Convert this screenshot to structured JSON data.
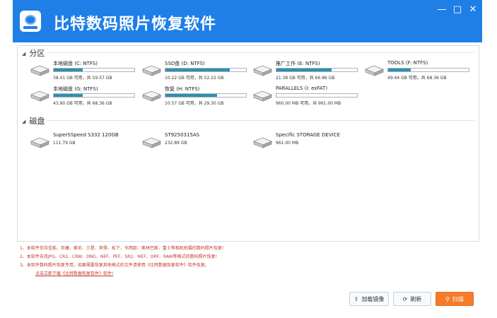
{
  "app": {
    "title": "比特数码照片恢复软件",
    "window_controls": {
      "minimize": "—",
      "maximize": "□",
      "close": "✕"
    }
  },
  "partitions": {
    "header": "分区",
    "items": [
      {
        "name": "本地磁盘 (C: NTFS)",
        "size": "38.41 GB 可用，共 59.57 GB",
        "used_fraction": 0.36
      },
      {
        "name": "SSD盘 (D: NTFS)",
        "size": "10.22 GB 可用，共 52.22 GB",
        "used_fraction": 0.8
      },
      {
        "name": "推广工作 (E: NTFS)",
        "size": "21.38 GB 可用，共 66.86 GB",
        "used_fraction": 0.68
      },
      {
        "name": "TOOLS (F: NTFS)",
        "size": "49.44 GB 可用，共 68.36 GB",
        "used_fraction": 0.28
      },
      {
        "name": "本地磁盘 (G: NTFS)",
        "size": "43.90 GB 可用，共 68.36 GB",
        "used_fraction": 0.36
      },
      {
        "name": "恢复 (H: NTFS)",
        "size": "10.57 GB 可用，共 29.30 GB",
        "used_fraction": 0.64
      },
      {
        "name": "PARALLELS (I: exFAT)",
        "size": "960.00 MB 可用，共 961.00 MB",
        "used_fraction": 0.0
      }
    ]
  },
  "disks": {
    "header": "磁盘",
    "items": [
      {
        "name": "SuperSSpeed S332 120GB",
        "size": "111.79 GB"
      },
      {
        "name": "ST9250315AS",
        "size": "232.89 GB"
      },
      {
        "name": "Specific STORAGE DEVICE",
        "size": "961.00 MB"
      }
    ]
  },
  "notes": [
    "1、本软件支持佳能、尼康、索尼、三星、宾得、松下、卡西欧、奥林巴斯、富士等相机拍摄的数码照片恢复!",
    "2、本软件支持JPG、CR2、CRW、DNG、NEF、PEF、SR2、MEF、ORF、RAW等格式的数码照片恢复!",
    "3、本软件数码照片恢复专用，如果需要恢复其他格式的文件请使用《比特数据恢复软件》软件恢复。"
  ],
  "download_link": "点击立即下载《比特数据恢复软件》软件!",
  "buttons": {
    "load_image": "加载镜像",
    "refresh": "刷新",
    "scan": "扫描"
  },
  "colors": {
    "title_bar": "#1f7fe6",
    "progress_fill": "#2e8fb0",
    "note_text": "#c0392b",
    "scan_button": "#f57b2b"
  }
}
